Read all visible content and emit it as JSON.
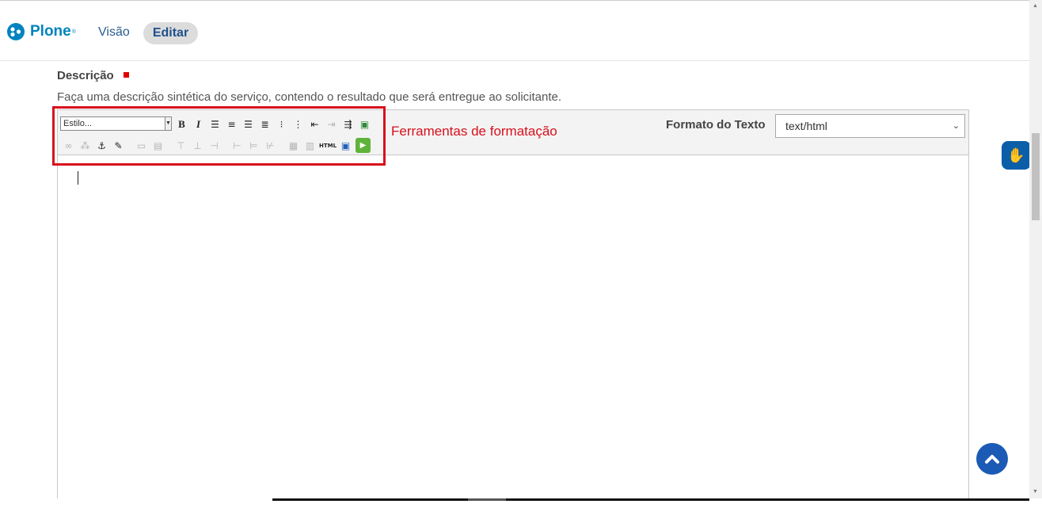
{
  "header": {
    "logo_text": "Plone",
    "logo_mark": "®",
    "nav": {
      "view_label": "Visão",
      "edit_label": "Editar"
    }
  },
  "field": {
    "label": "Descrição",
    "help": "Faça uma descrição sintética do serviço, contendo o resultado que será entregue ao solicitante."
  },
  "editor": {
    "style_select": {
      "value": "Estilo..."
    },
    "format_label": "Formato do Texto",
    "format_select": {
      "value": "text/html"
    },
    "toolbar_row1": [
      "bold-icon",
      "italic-icon",
      "align-left-icon",
      "align-center-icon",
      "align-right-icon",
      "align-justify-icon",
      "bullet-list-icon",
      "numbered-list-icon",
      "outdent-icon",
      "indent-icon",
      "definition-list-icon",
      "image-icon"
    ],
    "toolbar_row2": [
      "link-icon",
      "unlink-icon",
      "anchor-icon",
      "edit-icon",
      "table-icon",
      "table-props-icon",
      "row-before-icon",
      "row-after-icon",
      "delete-row-icon",
      "col-before-icon",
      "col-after-icon",
      "delete-col-icon",
      "visual-aid-icon",
      "media-icon",
      "html-source-icon",
      "fullscreen-icon",
      "play-icon"
    ],
    "html_button_label": "HTML"
  },
  "annotation": {
    "label": "Ferramentas de formatação",
    "color": "#d8101c"
  },
  "widgets": {
    "vlibras_icon": "sign-language-hand-icon",
    "back_to_top_icon": "chevron-up-icon"
  }
}
